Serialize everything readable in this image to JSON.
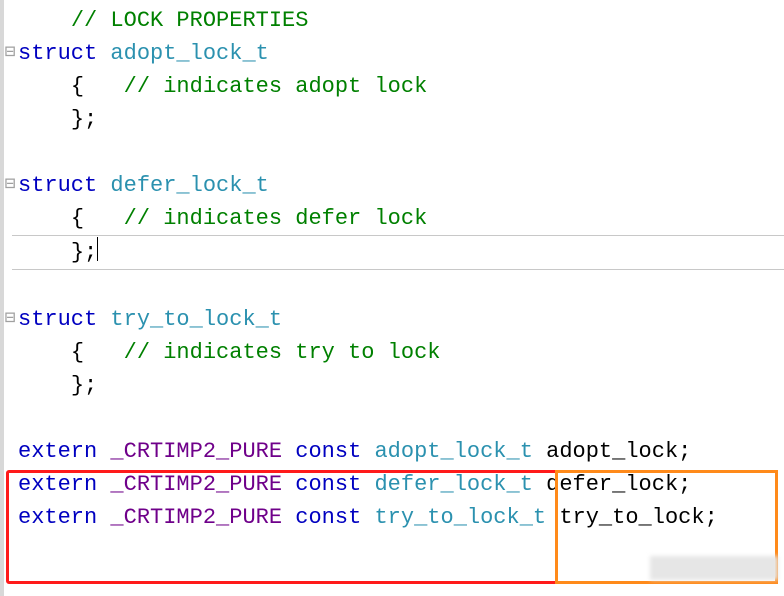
{
  "code": {
    "comment_header": "// LOCK PROPERTIES",
    "struct1": {
      "kw": "struct",
      "name": "adopt_lock_t",
      "open": "{",
      "comment": "// indicates adopt lock",
      "close": "};"
    },
    "struct2": {
      "kw": "struct",
      "name": "defer_lock_t",
      "open": "{",
      "comment": "// indicates defer lock",
      "close": "};"
    },
    "struct3": {
      "kw": "struct",
      "name": "try_to_lock_t",
      "open": "{",
      "comment": "// indicates try to lock",
      "close": "};"
    },
    "extern1": {
      "kw": "extern",
      "macro": "_CRTIMP2_PURE",
      "const": "const",
      "type": "adopt_lock_t",
      "var": "adopt_lock",
      "semi": ";"
    },
    "extern2": {
      "kw": "extern",
      "macro": "_CRTIMP2_PURE",
      "const": "const",
      "type": "defer_lock_t",
      "var": "defer_lock",
      "semi": ";"
    },
    "extern3": {
      "kw": "extern",
      "macro": "_CRTIMP2_PURE",
      "const": "const",
      "type": "try_to_lock_t",
      "var": "try_to_lock",
      "semi": ";"
    }
  },
  "colors": {
    "keyword": "#0000c0",
    "type": "#2b91af",
    "comment": "#008000",
    "macro": "#6f008a",
    "redbox": "#ff1a1a",
    "orangebox": "#ff8a1a"
  }
}
